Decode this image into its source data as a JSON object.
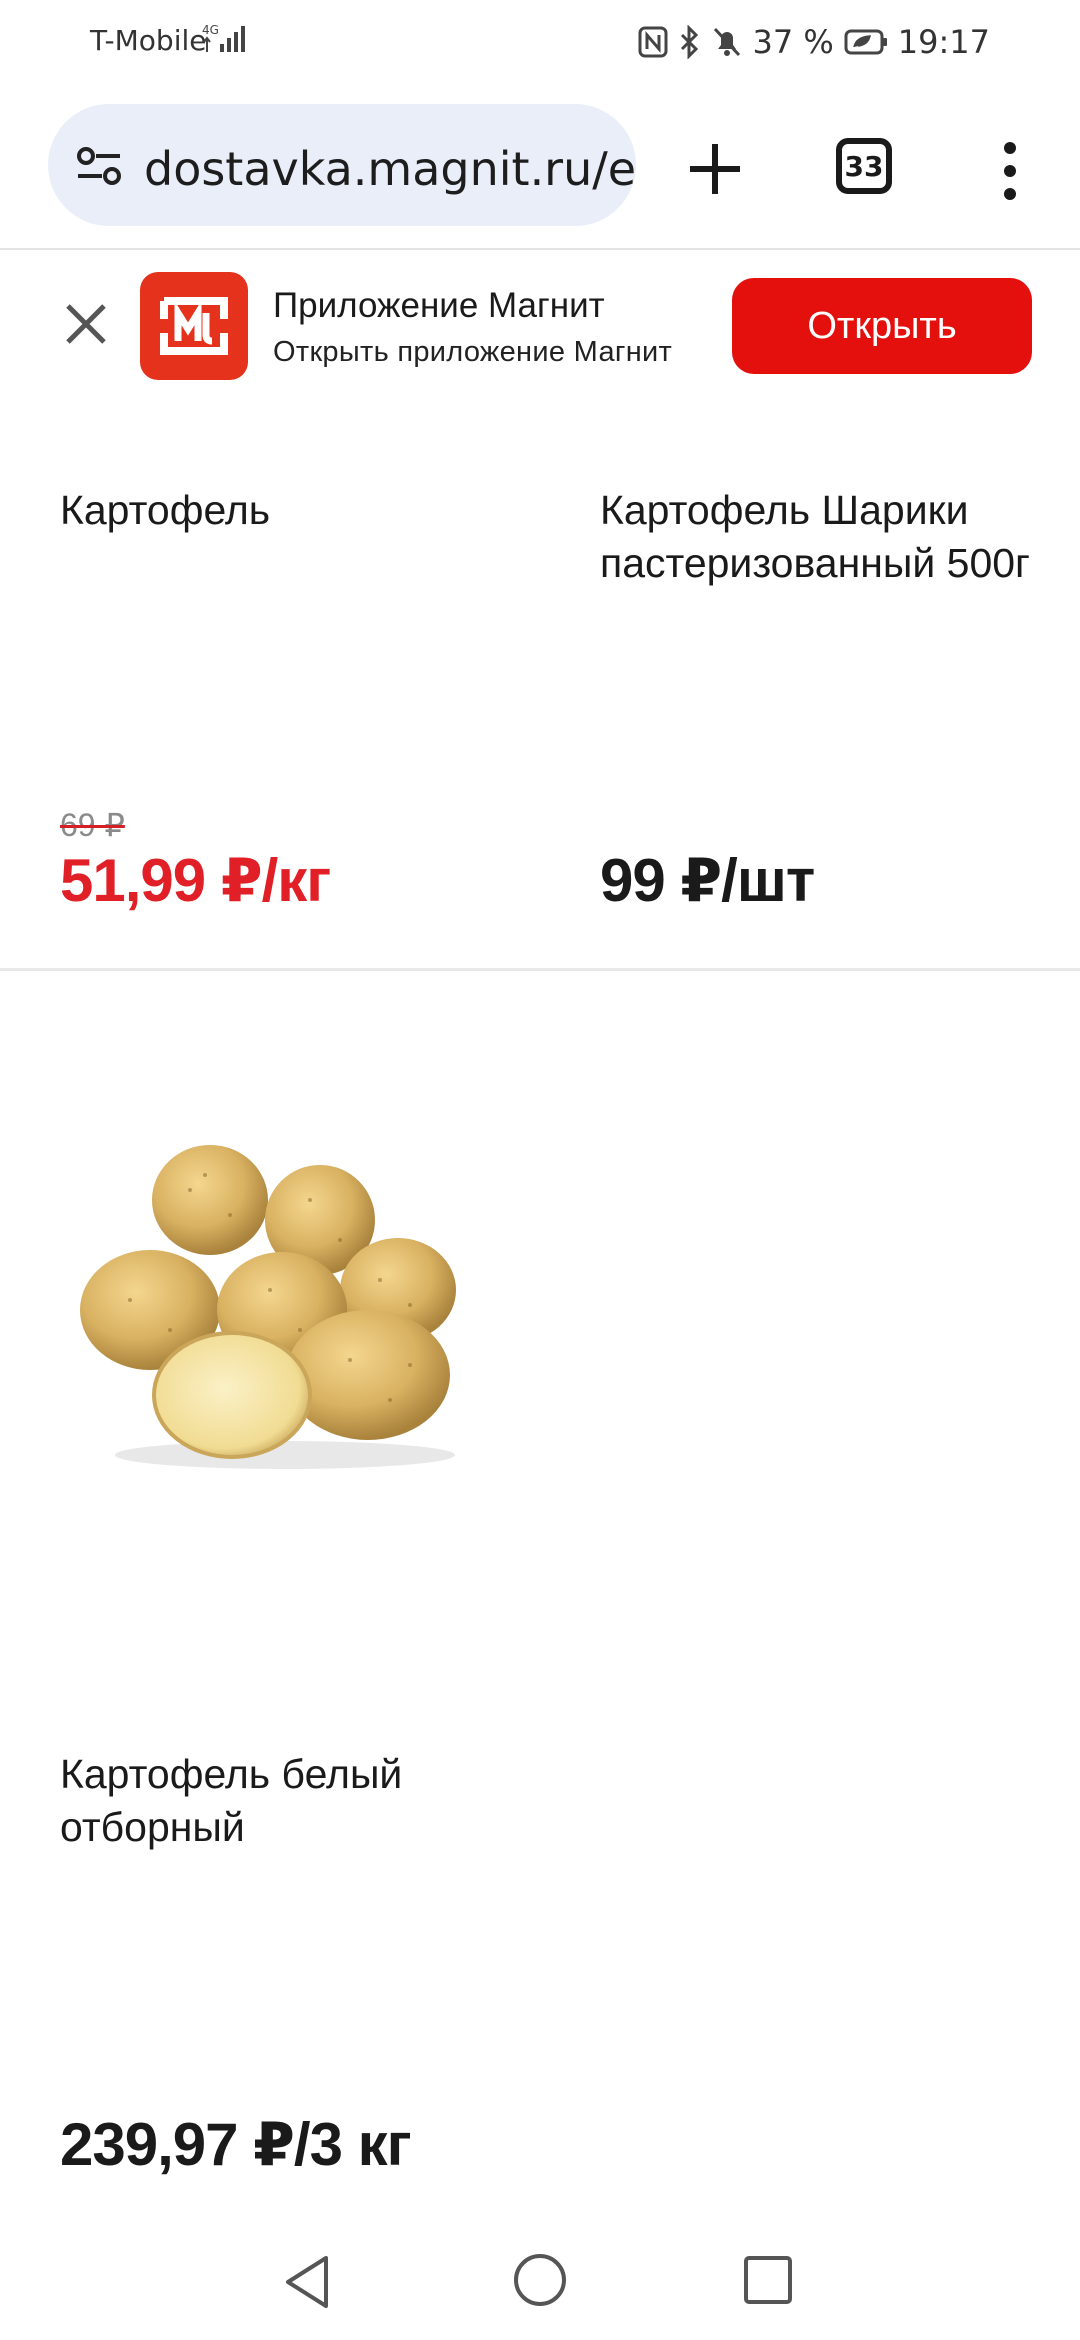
{
  "status_bar": {
    "carrier": "T-Mobile",
    "network": "4G",
    "battery": "37 %",
    "time": "19:17"
  },
  "browser": {
    "url": "dostavka.magnit.ru/ex",
    "tab_count": "33",
    "icons": [
      "tune-icon",
      "plus-icon",
      "tabs-icon",
      "more-vert-icon"
    ]
  },
  "app_banner": {
    "title": "Приложение Магнит",
    "subtitle": "Открыть приложение Магнит",
    "open_label": "Открыть",
    "brand_color": "#e3100d"
  },
  "products": [
    {
      "title": "Картофель",
      "old_price": "69 ₽",
      "price": "51,99 ₽/кг",
      "price_color": "#e01f26"
    },
    {
      "title": "Картофель Шарики пастеризованный 500г",
      "price": "99 ₽/шт"
    },
    {
      "title": "Картофель белый отборный",
      "price": "239,97 ₽/3 кг",
      "image": "potatoes"
    }
  ],
  "nav_bar": {
    "icons": [
      "back-icon",
      "home-icon",
      "recents-icon"
    ]
  }
}
